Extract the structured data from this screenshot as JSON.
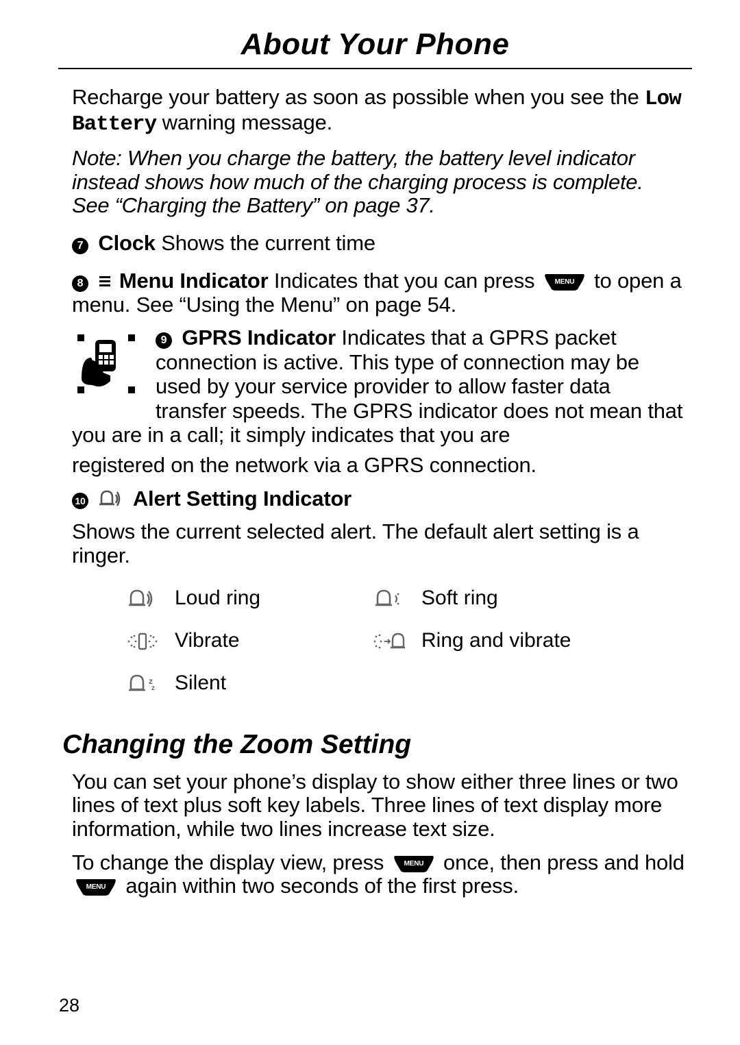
{
  "title": "About Your Phone",
  "p1": {
    "a": "Recharge your battery as soon as possible when you see the ",
    "low": "Low",
    "battery": "Battery",
    "b": " warning message."
  },
  "note": "Note: When you charge the battery, the battery level indicator instead shows how much of the charging process is complete. See “Charging the Battery” on page 37.",
  "item7": {
    "num": "7",
    "name": "Clock",
    "rest": "  Shows the current time"
  },
  "item8": {
    "num": "8",
    "name": "Menu Indicator",
    "rest_a": "  Indicates that you can press ",
    "rest_b": " to open a menu. See “Using the Menu” on page 54."
  },
  "item9": {
    "num": "9",
    "name": "GPRS Indicator",
    "rest": " Indicates that a GPRS packet connection is active. This type of connection may be used by your service provider to allow faster data transfer speeds. The GPRS indicator does not mean that you are in a call; it simply indicates that you are",
    "cont": "registered on the network via a GPRS connection."
  },
  "item10": {
    "num": "10",
    "name": "Alert Setting Indicator"
  },
  "alert_desc": "Shows the current selected alert. The default alert setting is a ringer.",
  "alerts": {
    "loud": "Loud ring",
    "soft": "Soft ring",
    "vibrate": "Vibrate",
    "ringvib": "Ring and vibrate",
    "silent": "Silent"
  },
  "h2": "Changing the Zoom Setting",
  "zoom_p1": "You can set your phone’s display to show either three lines or two lines of text plus soft key labels. Three lines of text display more information, while two lines increase text size.",
  "zoom_p2": {
    "a": "To change the display view, press ",
    "b": " once, then press and hold ",
    "c": " again within two seconds of the first press."
  },
  "menu_label": "MENU",
  "page_number": "28"
}
